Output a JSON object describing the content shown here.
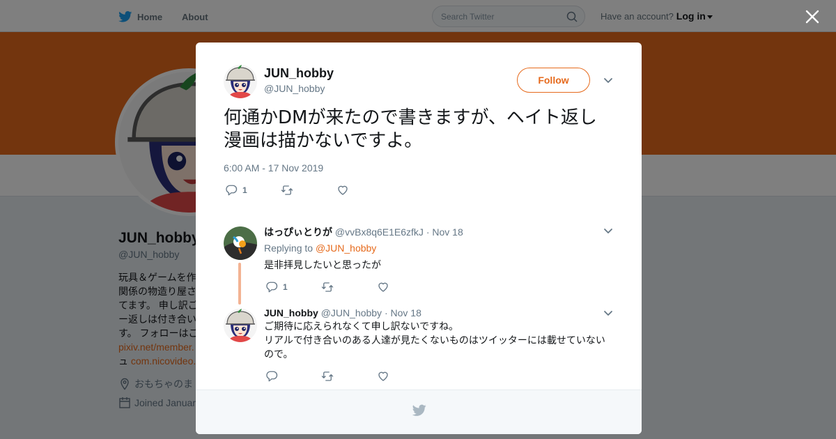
{
  "header": {
    "home_label": "Home",
    "about_label": "About",
    "search_placeholder": "Search Twitter",
    "account_prompt": "Have an account?",
    "login_label": "Log in"
  },
  "profile": {
    "name": "JUN_hobby",
    "handle": "@JUN_hobby",
    "bio_lines": [
      "玩具＆ゲームを作",
      "関係の物造り屋さ",
      "てます。 申し訳ご",
      "ー返しは付き合い",
      "す。 フォローはご"
    ],
    "link1": "pixiv.net/member.",
    "link2_prefix": "ュ",
    "link2": "com.nicovideo.",
    "location": "おもちゃのま",
    "joined": "Joined Januar"
  },
  "tweet": {
    "author_name": "JUN_hobby",
    "author_handle": "@JUN_hobby",
    "follow_label": "Follow",
    "text": "何通かDMが来たので書きますが、ヘイト返し漫画は描かないですよ。",
    "timestamp": "6:00 AM - 17 Nov 2019",
    "reply_count": "1",
    "retweet_count": "",
    "like_count": ""
  },
  "replies": [
    {
      "name": "はっぴぃとりが",
      "handle": "@vvBx8q6E1E6zfkJ",
      "date": "· Nov 18",
      "replying_prefix": "Replying to",
      "replying_to": "@JUN_hobby",
      "text": "是非拝見したいと思ったが",
      "reply_count": "1",
      "retweet_count": "",
      "like_count": ""
    },
    {
      "name": "JUN_hobby",
      "handle": "@JUN_hobby",
      "date": "· Nov 18",
      "text_line1": "ご期待に応えられなくて申し訳ないですね。",
      "text_line2": "リアルで付き合いのある人達が見たくないものはツイッターには載せていないので。",
      "reply_count": "",
      "retweet_count": "",
      "like_count": ""
    }
  ],
  "colors": {
    "accent": "#e66a1c",
    "twitter_blue": "#1da1f2",
    "thread_line": "#f3b393",
    "overlay": "rgba(0,0,0,0.5)"
  },
  "icons": {
    "logo": "twitter-bird-icon",
    "search": "search-icon",
    "close": "close-icon",
    "more": "chevron-down-icon",
    "reply": "reply-icon",
    "retweet": "retweet-icon",
    "like": "heart-icon",
    "location": "location-pin-icon",
    "calendar": "calendar-icon"
  }
}
